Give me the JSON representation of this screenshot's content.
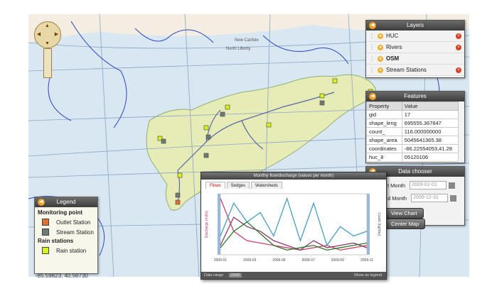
{
  "map": {
    "place_names": [
      "New Carlisle",
      "North Liberty"
    ],
    "coordinates": "-85.59823, 40.56730"
  },
  "nav": {
    "up": "▲",
    "down": "▼",
    "left": "◀",
    "right": "▶"
  },
  "layers": {
    "title": "Layers",
    "items": [
      {
        "label": "HUC",
        "removable": true
      },
      {
        "label": "Rivers",
        "removable": true
      },
      {
        "label": "OSM",
        "removable": false
      },
      {
        "label": "Stream Stations",
        "removable": true
      }
    ]
  },
  "features": {
    "title": "Features",
    "headers": [
      "Property",
      "Value"
    ],
    "rows": [
      [
        "gid",
        "17"
      ],
      [
        "shape_leng",
        "695555.367847"
      ],
      [
        "count_",
        "116.000000000"
      ],
      [
        "shape_area",
        "5045641365.38"
      ],
      [
        "coordinates",
        "-86.22554053,41.28"
      ],
      [
        "huc_8",
        "05120106"
      ]
    ]
  },
  "data_chooser": {
    "title": "Data chooser",
    "start_label": "t Month",
    "start_value": "2009-01-01",
    "end_label": "d Month",
    "end_value": "2009-12-31",
    "view_chart": "View Chart",
    "center_map": "Center Map"
  },
  "legend": {
    "title": "Legend",
    "section1": "Monitoring point",
    "outlet": "Outlet Station",
    "stream": "Stream Station",
    "section2": "Rain stations",
    "rain": "Rain station"
  },
  "chart_window": {
    "title": "Monthly flow/discharge (values per month)",
    "tabs": [
      "Flows",
      "Sedges",
      "Watersheds"
    ],
    "footer": "Data range",
    "footer_value": "2009",
    "show_legend": "Show as legend",
    "ylabel_left": "Discharge (m3/s)",
    "ylabel_right": "Loads (kg/day)"
  },
  "chart_data": {
    "type": "line",
    "x": [
      "2009-01",
      "2009-03",
      "2009-05",
      "2009-07",
      "2009-09",
      "2009-11"
    ],
    "series": [
      {
        "values": [
          120,
          50,
          30,
          25,
          20,
          15,
          10,
          15,
          20,
          10,
          15,
          20
        ]
      },
      {
        "values": [
          40,
          110,
          70,
          90,
          40,
          120,
          30,
          110,
          20,
          60,
          40,
          50
        ]
      },
      {
        "values": [
          20,
          80,
          60,
          50,
          30,
          20,
          10,
          30,
          15,
          20,
          25,
          15
        ]
      },
      {
        "values": [
          15,
          50,
          70,
          45,
          20,
          10,
          15,
          20,
          10,
          15,
          20,
          25
        ]
      }
    ],
    "colors": [
      "#d0406a",
      "#4a9cc0",
      "#8a3a6a",
      "#2a7a2a"
    ]
  }
}
